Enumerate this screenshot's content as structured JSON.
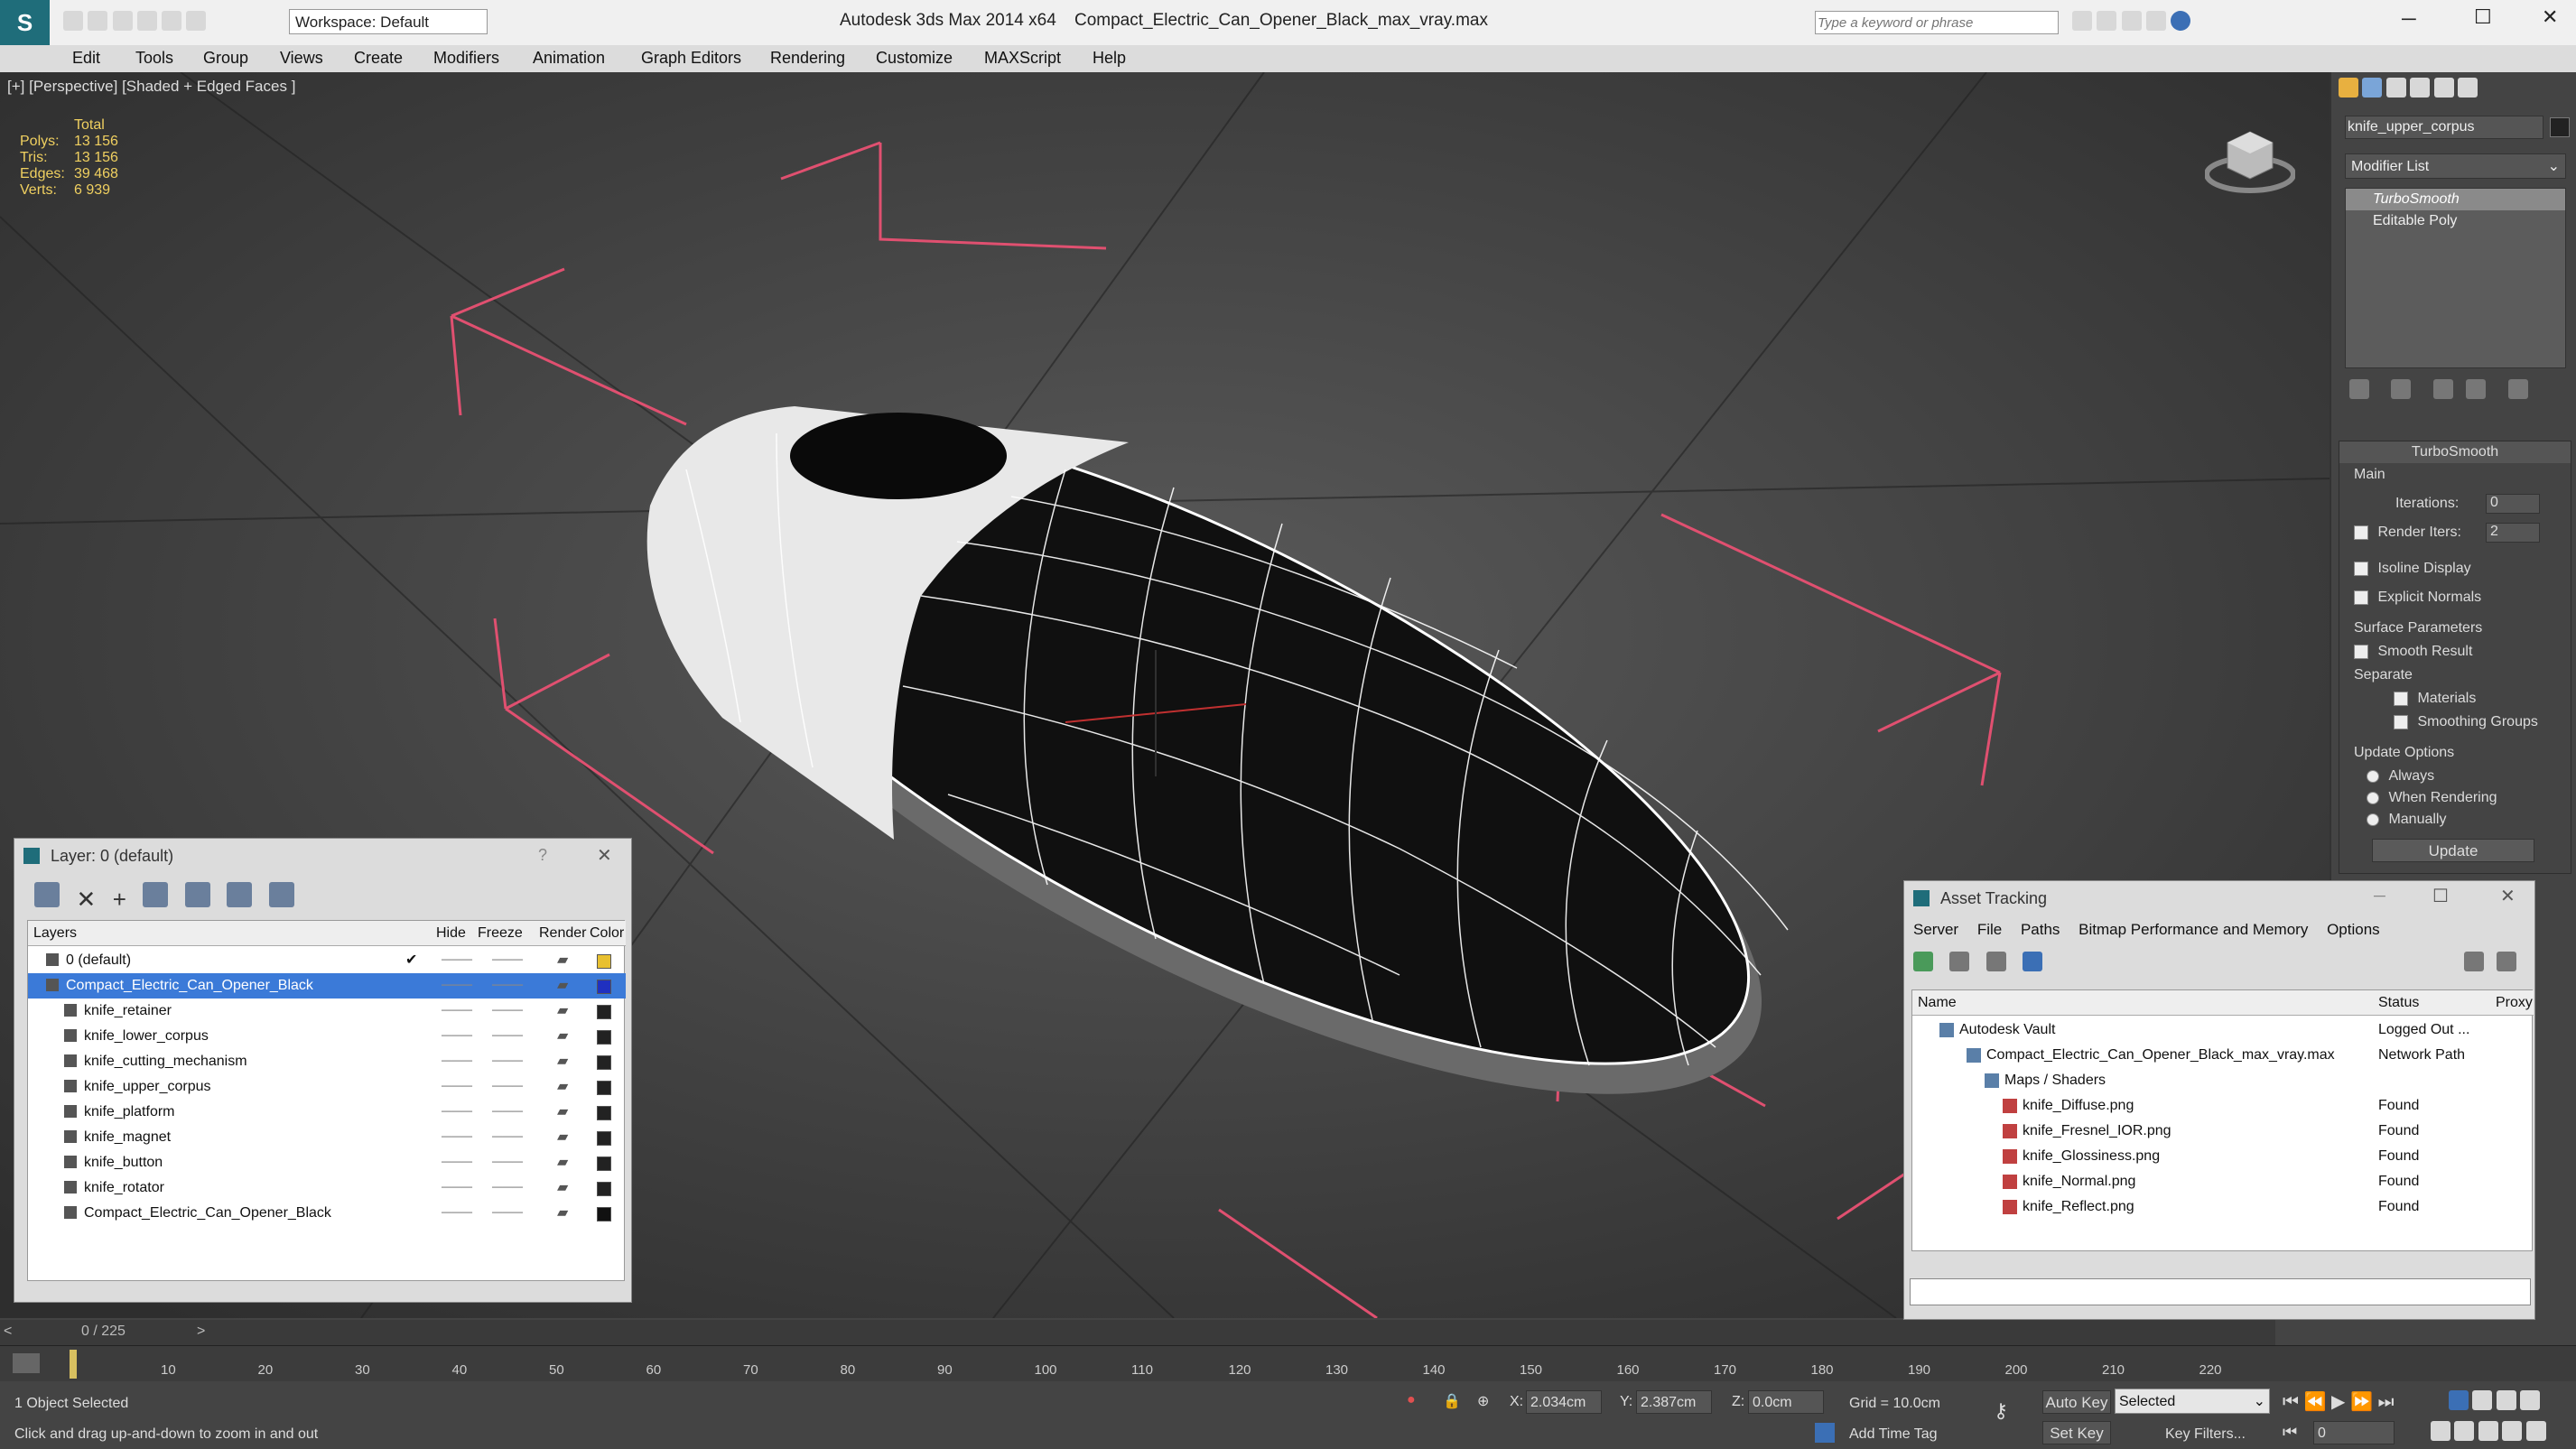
{
  "app": {
    "title": "Autodesk 3ds Max  2014 x64",
    "filename": "Compact_Electric_Can_Opener_Black_max_vray.max",
    "workspace": "Workspace: Default",
    "search_placeholder": "Type a keyword or phrase"
  },
  "menu": [
    "Edit",
    "Tools",
    "Group",
    "Views",
    "Create",
    "Modifiers",
    "Animation",
    "Graph Editors",
    "Rendering",
    "Customize",
    "MAXScript",
    "Help"
  ],
  "viewport": {
    "label": "[+] [Perspective] [Shaded + Edged Faces ]",
    "stats_header": "Total",
    "stats": [
      {
        "label": "Polys:",
        "value": "13 156"
      },
      {
        "label": "Tris:",
        "value": "13 156"
      },
      {
        "label": "Edges:",
        "value": "39 468"
      },
      {
        "label": "Verts:",
        "value": "6 939"
      }
    ]
  },
  "command_panel": {
    "object_name": "knife_upper_corpus",
    "modifier_list": "Modifier List",
    "stack": [
      "TurboSmooth",
      "Editable Poly"
    ],
    "rollout_title": "TurboSmooth",
    "main_label": "Main",
    "iterations_label": "Iterations:",
    "iterations_value": "0",
    "render_iters_label": "Render Iters:",
    "render_iters_value": "2",
    "isoline": "Isoline Display",
    "explicit_normals": "Explicit Normals",
    "surface_params": "Surface Parameters",
    "smooth_result": "Smooth Result",
    "separate": "Separate",
    "materials": "Materials",
    "smoothing_groups": "Smoothing Groups",
    "update_options": "Update Options",
    "always": "Always",
    "when_rendering": "When Rendering",
    "manually": "Manually",
    "update_button": "Update"
  },
  "layer_panel": {
    "title": "Layer: 0 (default)",
    "help": "?",
    "columns": [
      "Layers",
      "Hide",
      "Freeze",
      "Render",
      "Color"
    ],
    "rows": [
      {
        "name": "0 (default)",
        "color": "#e8c030"
      },
      {
        "name": "Compact_Electric_Can_Opener_Black",
        "color": "#2030c0"
      },
      {
        "name": "knife_retainer",
        "color": "#222222"
      },
      {
        "name": "knife_lower_corpus",
        "color": "#222222"
      },
      {
        "name": "knife_cutting_mechanism",
        "color": "#222222"
      },
      {
        "name": "knife_upper_corpus",
        "color": "#222222"
      },
      {
        "name": "knife_platform",
        "color": "#222222"
      },
      {
        "name": "knife_magnet",
        "color": "#222222"
      },
      {
        "name": "knife_button",
        "color": "#222222"
      },
      {
        "name": "knife_rotator",
        "color": "#222222"
      },
      {
        "name": "Compact_Electric_Can_Opener_Black",
        "color": "#111111"
      }
    ]
  },
  "asset_panel": {
    "title": "Asset Tracking",
    "menu": [
      "Server",
      "File",
      "Paths",
      "Bitmap Performance and Memory",
      "Options"
    ],
    "columns": [
      "Name",
      "Status",
      "Proxy"
    ],
    "rows": [
      {
        "name": "Autodesk Vault",
        "status": "Logged Out ..."
      },
      {
        "name": "Compact_Electric_Can_Opener_Black_max_vray.max",
        "status": "Network Path"
      },
      {
        "name": "Maps / Shaders",
        "status": ""
      },
      {
        "name": "knife_Diffuse.png",
        "status": "Found"
      },
      {
        "name": "knife_Fresnel_IOR.png",
        "status": "Found"
      },
      {
        "name": "knife_Glossiness.png",
        "status": "Found"
      },
      {
        "name": "knife_Normal.png",
        "status": "Found"
      },
      {
        "name": "knife_Reflect.png",
        "status": "Found"
      }
    ]
  },
  "timeline": {
    "frame": "0 / 225",
    "ticks": [
      "10",
      "20",
      "30",
      "40",
      "50",
      "60",
      "70",
      "80",
      "90",
      "100",
      "110",
      "120",
      "130",
      "140",
      "150",
      "160",
      "170",
      "180",
      "190",
      "200",
      "210",
      "220"
    ]
  },
  "status": {
    "selected": "1 Object Selected",
    "hint": "Click and drag up-and-down to zoom in and out",
    "x": "2.034cm",
    "y": "2.387cm",
    "z": "0.0cm",
    "grid": "Grid = 10.0cm",
    "auto_key": "Auto Key",
    "selected_dd": "Selected",
    "set_key": "Set Key",
    "key_filters": "Key Filters...",
    "add_time_tag": "Add Time Tag",
    "frame_field": "0"
  }
}
